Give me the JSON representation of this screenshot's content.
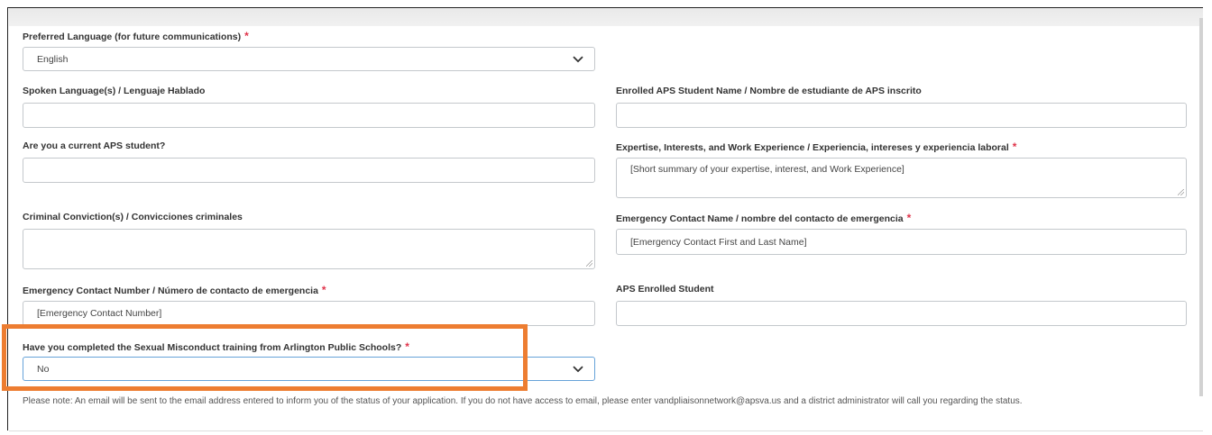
{
  "form": {
    "preferred_language": {
      "label": "Preferred Language (for future communications)",
      "value": "English"
    },
    "spoken_language": {
      "label": "Spoken Language(s) / Lenguaje Hablado",
      "value": ""
    },
    "enrolled_student_name": {
      "label": "Enrolled APS Student Name / Nombre de estudiante de APS inscrito",
      "value": ""
    },
    "current_student": {
      "label": "Are you a current APS student?",
      "value": ""
    },
    "expertise": {
      "label": "Expertise, Interests, and Work Experience / Experiencia, intereses y experiencia laboral",
      "placeholder": "[Short summary of your expertise, interest, and Work Experience]"
    },
    "criminal_convictions": {
      "label": "Criminal Conviction(s) / Convicciones criminales",
      "value": ""
    },
    "emergency_contact_name": {
      "label": "Emergency Contact Name / nombre del contacto de emergencia",
      "placeholder": "[Emergency Contact First and Last Name]"
    },
    "emergency_contact_number": {
      "label": "Emergency Contact Number / Número de contacto de emergencia",
      "placeholder": "[Emergency Contact Number]"
    },
    "aps_enrolled_student": {
      "label": "APS Enrolled Student",
      "value": ""
    },
    "misconduct_training": {
      "label": "Have you completed the Sexual Misconduct training from Arlington Public Schools?",
      "value": "No"
    },
    "required_marker": "*",
    "note": "Please note: An email will be sent to the email address entered to inform you of the status of your application. If you do not have access to email, please enter vandpliaisonnetwork@apsva.us and a district administrator will call you regarding the status."
  },
  "colors": {
    "required": "#e0344b",
    "highlight": "#ed7d31",
    "border": "#c4c8cc"
  },
  "icons": {
    "dropdown": "chevron-down-icon",
    "resize": "resize-handle-icon"
  }
}
